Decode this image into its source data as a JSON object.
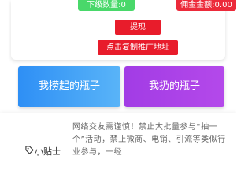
{
  "stats": {
    "subordinate_count": "下级数量:0",
    "commission_amount": "佣金金额:0.00"
  },
  "actions": {
    "withdraw_label": "提现",
    "copy_link_label": "点击复制推广地址"
  },
  "bottles": {
    "picked_label": "我捞起的瓶子",
    "thrown_label": "我扔的瓶子"
  },
  "tips": {
    "icon": "tag-icon",
    "title": "小贴士",
    "content": "网络交友需谨慎！禁止大批量参与“抽一个”活动，禁止微商、电销、引流等类似行业参与，一经"
  },
  "colors": {
    "green": "#49d86a",
    "red": "#e81c2b",
    "blue": "#2e8ff5",
    "purple": "#a23ce5"
  }
}
